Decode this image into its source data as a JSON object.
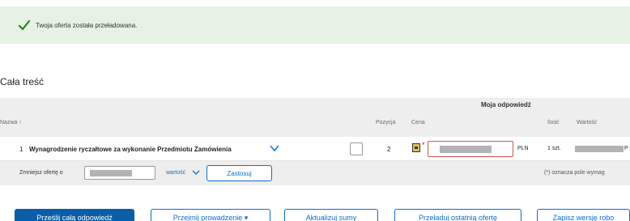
{
  "banner": {
    "message": "Twoja oferta została przeładowana."
  },
  "section": {
    "title": "Cała treść"
  },
  "table": {
    "group_header": "Moja odpowiedź",
    "columns": {
      "name": "Nazwa ↑",
      "position": "Pozycja",
      "price": "Cena",
      "quantity": "Ilość",
      "value": "Wartość"
    },
    "rows": [
      {
        "num": "1",
        "title": "Wynagrodzenie ryczałtowe za wykonanie Przedmiotu Zamówienia",
        "position": "2",
        "currency": "PLN",
        "quantity": "1 szt.",
        "value_suffix": "P"
      }
    ]
  },
  "reduce": {
    "label": "Zmniejsz ofertę o",
    "mode": "wartość",
    "apply_label": "Zastosuj"
  },
  "required_note": "(*) oznacza pole wymag",
  "actions": {
    "send_all": "Prześlij całą odpowiedź",
    "take_over": "Przejmij prowadzenie ▾",
    "update_sums": "Aktualizuj sumy",
    "reload_last": "Przeładuj ostatnią ofertę",
    "save_draft": "Zapisz wersję robo"
  },
  "colors": {
    "banner_bg": "#e6f2e3",
    "check": "#2b7d2b",
    "accent": "#0a6ed1",
    "primary": "#0a5ea8",
    "error": "#d0021b"
  }
}
